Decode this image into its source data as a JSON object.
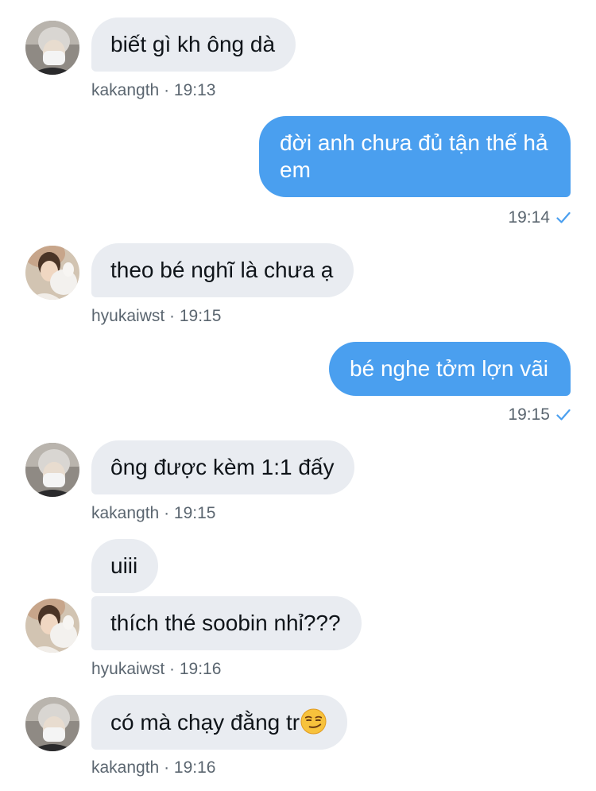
{
  "messages": [
    {
      "sender": "kakangth",
      "text": "biết gì kh ông dà",
      "time": "kakangth · 19:13"
    },
    {
      "sender": "me",
      "text": "đời anh chưa đủ tận thế hả em",
      "time": "19:14"
    },
    {
      "sender": "hyukaiwst",
      "text": "theo bé nghĩ là chưa ạ",
      "time": "hyukaiwst · 19:15"
    },
    {
      "sender": "me",
      "text": "bé nghe tởm lợn vãi",
      "time": "19:15"
    },
    {
      "sender": "kakangth",
      "text": "ông được kèm 1:1 đấy",
      "time": "kakangth · 19:15"
    },
    {
      "sender": "hyukaiwst",
      "text": "uiii"
    },
    {
      "sender": "hyukaiwst",
      "text": "thích thé soobin nhỉ???",
      "time": "hyukaiwst · 19:16"
    },
    {
      "sender": "kakangth",
      "text": "có mà chạy đằng tr",
      "emoji": "smirking-face-emoji",
      "time": "kakangth · 19:16"
    }
  ],
  "colors": {
    "incoming_bubble": "#e9ecf1",
    "outgoing_bubble": "#4a9fef",
    "meta_text": "#5b6670",
    "read_check": "#4a9fef"
  },
  "icons": {
    "read_receipt": "checkmark-icon",
    "avatar_kakangth": "avatar-masked-person",
    "avatar_hyukaiwst": "avatar-person-with-plush"
  }
}
